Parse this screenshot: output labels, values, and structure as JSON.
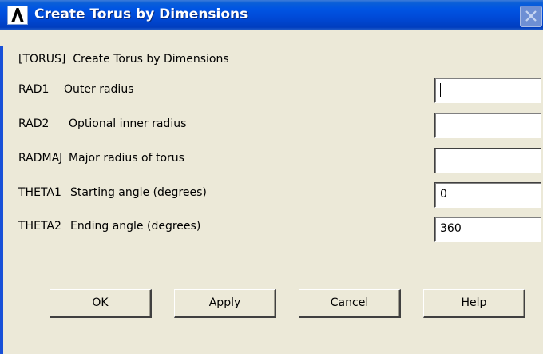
{
  "window": {
    "title": "Create Torus by Dimensions",
    "logo_letter": "Λ"
  },
  "dialog": {
    "header": "[TORUS]  Create Torus by Dimensions",
    "fields": [
      {
        "code": "RAD1",
        "label": "Outer radius",
        "value": ""
      },
      {
        "code": "RAD2",
        "label": "Optional inner radius",
        "value": ""
      },
      {
        "code": "RADMAJ",
        "label": "Major radius of torus",
        "value": ""
      },
      {
        "code": "THETA1",
        "label": "Starting angle (degrees)",
        "value": "0"
      },
      {
        "code": "THETA2",
        "label": "Ending angle (degrees)",
        "value": "360"
      }
    ]
  },
  "buttons": {
    "ok": "OK",
    "apply": "Apply",
    "cancel": "Cancel",
    "help": "Help"
  },
  "colors": {
    "titlebar": "#0054e3",
    "dialog_bg": "#ece9d8",
    "field_bg": "#ffffff"
  }
}
